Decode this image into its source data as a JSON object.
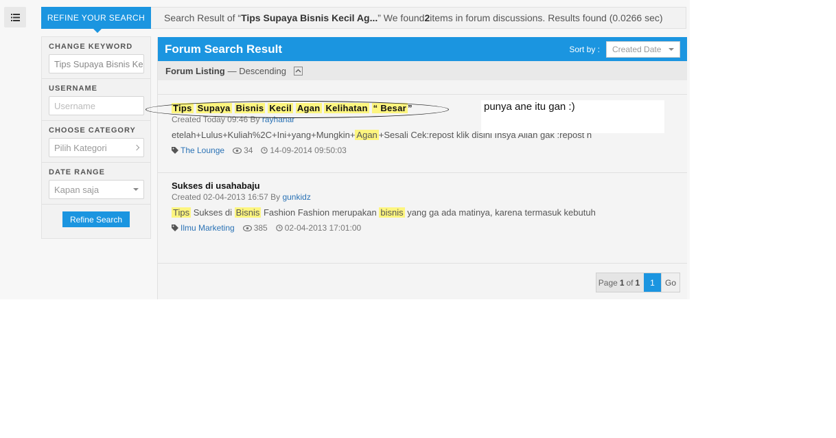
{
  "topbar": {
    "refine_tab": "REFINE YOUR SEARCH",
    "prefix": "Search Result of “",
    "query": "Tips Supaya Bisnis Kecil Ag...",
    "mid": "” We found ",
    "count": "2",
    "suffix": " items in forum discussions. Results found (0.0266 sec)"
  },
  "sidebar": {
    "keyword_label": "CHANGE KEYWORD",
    "keyword_value": "Tips Supaya Bisnis Ke",
    "username_label": "USERNAME",
    "username_placeholder": "Username",
    "category_label": "CHOOSE CATEGORY",
    "category_value": "Pilih Kategori",
    "date_label": "DATE RANGE",
    "date_value": "Kapan saja",
    "refine_button": "Refine Search"
  },
  "results": {
    "title": "Forum Search Result",
    "sort_label": "Sort by :",
    "sort_value": "Created Date",
    "listing_label": "Forum Listing",
    "listing_order": "— Descending",
    "items": [
      {
        "title_parts": [
          "Tips",
          "Supaya",
          "Bisnis",
          "Kecil",
          "Agan",
          "Kelihatan",
          "“ Besar"
        ],
        "title_trailing": "”",
        "created": "Created Today 09:46 By",
        "author": "rayhanar",
        "snippet_pre": "etelah+Lulus+Kuliah%2C+Ini+yang+Mungkin+",
        "snippet_hl": "Agan",
        "snippet_post": "+Sesali Cek:repost klik disini Insya Allah gak :repost h",
        "category": "The Lounge",
        "views": "34",
        "date": "14-09-2014 09:50:03"
      },
      {
        "title": "Sukses di usahabaju",
        "created": "Created 02-04-2013 16:57 By",
        "author": "gunkidz",
        "snippet_hl1": "Tips",
        "snippet_mid1": " Sukses di ",
        "snippet_hl2": "Bisnis",
        "snippet_mid2": " Fashion Fashion merupakan ",
        "snippet_hl3": "bisnis",
        "snippet_post": " yang ga ada matinya, karena termasuk kebutuh",
        "category": "Ilmu Marketing",
        "views": "385",
        "date": "02-04-2013 17:01:00"
      }
    ],
    "pager": {
      "page_word": "Page",
      "current": "1",
      "of_word": "of",
      "total": "1",
      "button": "1",
      "go": "Go"
    }
  },
  "annotation": {
    "note": "punya ane itu gan :)"
  },
  "colors": {
    "accent": "#1b95e0",
    "highlight": "#fdf57f",
    "link": "#2a72b5"
  }
}
